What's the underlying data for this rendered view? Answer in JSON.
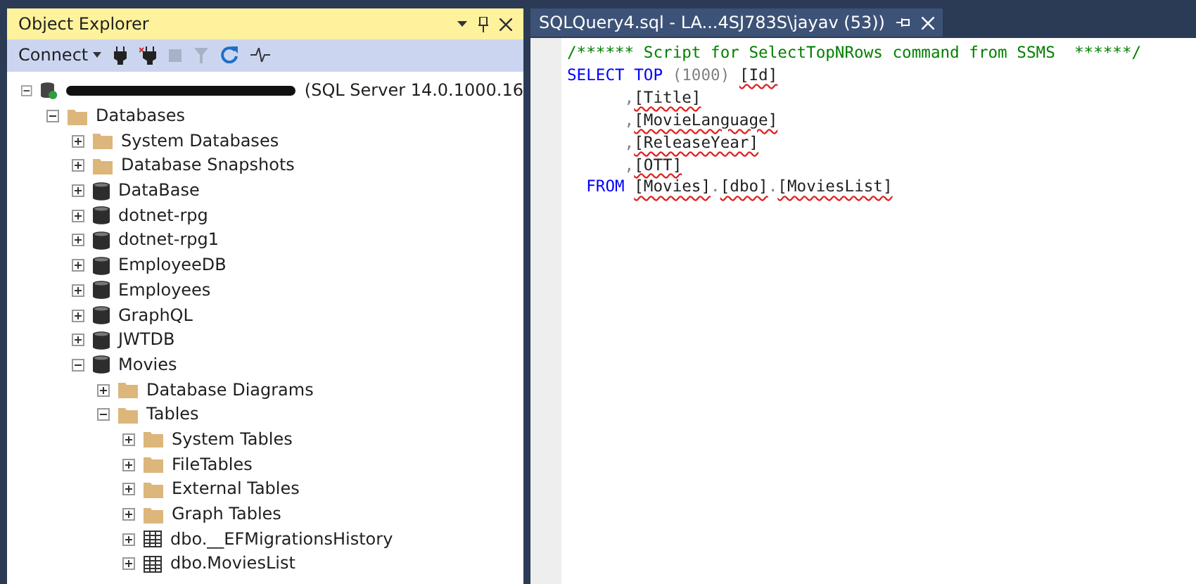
{
  "object_explorer": {
    "title": "Object Explorer",
    "toolbar": {
      "connect": "Connect"
    },
    "tree": [
      {
        "label": "(SQL Server 14.0.1000.16",
        "kind": "server",
        "redacted": true,
        "expanded": true,
        "children": [
          {
            "label": "Databases",
            "kind": "folder",
            "expanded": true,
            "children": [
              {
                "label": "System Databases",
                "kind": "folder",
                "expanded": false
              },
              {
                "label": "Database Snapshots",
                "kind": "folder",
                "expanded": false
              },
              {
                "label": "DataBase",
                "kind": "database",
                "expanded": false
              },
              {
                "label": "dotnet-rpg",
                "kind": "database",
                "expanded": false
              },
              {
                "label": "dotnet-rpg1",
                "kind": "database",
                "expanded": false
              },
              {
                "label": "EmployeeDB",
                "kind": "database",
                "expanded": false
              },
              {
                "label": "Employees",
                "kind": "database",
                "expanded": false
              },
              {
                "label": "GraphQL",
                "kind": "database",
                "expanded": false
              },
              {
                "label": "JWTDB",
                "kind": "database",
                "expanded": false
              },
              {
                "label": "Movies",
                "kind": "database",
                "expanded": true,
                "children": [
                  {
                    "label": "Database Diagrams",
                    "kind": "folder",
                    "expanded": false
                  },
                  {
                    "label": "Tables",
                    "kind": "folder",
                    "expanded": true,
                    "children": [
                      {
                        "label": "System Tables",
                        "kind": "folder",
                        "expanded": false
                      },
                      {
                        "label": "FileTables",
                        "kind": "folder",
                        "expanded": false
                      },
                      {
                        "label": "External Tables",
                        "kind": "folder",
                        "expanded": false
                      },
                      {
                        "label": "Graph Tables",
                        "kind": "folder",
                        "expanded": false
                      },
                      {
                        "label": "dbo.__EFMigrationsHistory",
                        "kind": "table",
                        "expanded": false
                      },
                      {
                        "label": "dbo.MoviesList",
                        "kind": "table",
                        "expanded": false
                      }
                    ]
                  }
                ]
              }
            ]
          }
        ]
      }
    ]
  },
  "editor": {
    "tab": {
      "title": "SQLQuery4.sql - LA...4SJ783S\\jayav (53))",
      "selected": true
    },
    "lines": [
      [
        {
          "kind": "comment",
          "text": "/****** Script for SelectTopNRows command from SSMS  ******/"
        }
      ],
      [
        {
          "kind": "keyword",
          "text": "SELECT TOP "
        },
        {
          "kind": "punct",
          "text": "(1000) "
        },
        {
          "kind": "ident",
          "text": "[Id]",
          "squiggle": true
        }
      ],
      [
        {
          "kind": "punct",
          "text": "      ,"
        },
        {
          "kind": "ident",
          "text": "[Title]",
          "squiggle": true
        }
      ],
      [
        {
          "kind": "punct",
          "text": "      ,"
        },
        {
          "kind": "ident",
          "text": "[MovieLanguage]",
          "squiggle": true
        }
      ],
      [
        {
          "kind": "punct",
          "text": "      ,"
        },
        {
          "kind": "ident",
          "text": "[ReleaseYear]",
          "squiggle": true
        }
      ],
      [
        {
          "kind": "punct",
          "text": "      ,"
        },
        {
          "kind": "ident",
          "text": "[OTT]",
          "squiggle": true
        }
      ],
      [
        {
          "kind": "keyword",
          "text": "  FROM "
        },
        {
          "kind": "ident",
          "text": "[Movies]",
          "squiggle": true
        },
        {
          "kind": "punct",
          "text": "."
        },
        {
          "kind": "ident",
          "text": "[dbo]",
          "squiggle": true
        },
        {
          "kind": "punct",
          "text": "."
        },
        {
          "kind": "ident",
          "text": "[MoviesList]",
          "squiggle": true
        }
      ]
    ]
  }
}
